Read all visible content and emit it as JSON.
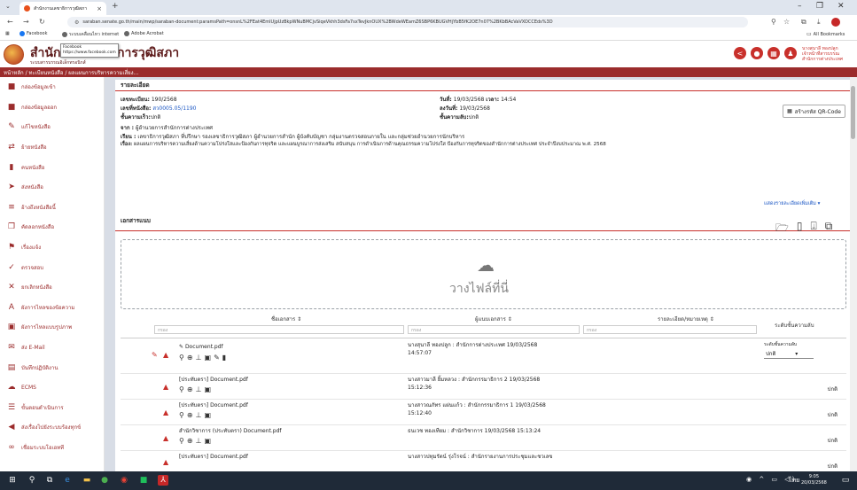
{
  "browser": {
    "tab_title": "สำนักงานเลขาธิการวุฒิสภา",
    "url": "saraban.senate.go.th/main/mwp/saraban-document:paramsPath=onsnL%2FEat4EmlUjpUzBkpWNuBMCjvSiqeVkhh3dsFa7sxTevJknOUX%2BWdeWEamZ6SBP6KBUGVHjYbB5fK2OE7n07%2BKbBAcVaVXOCCEds%3D",
    "bookmarks": [
      "Facebook",
      "ระบบเคลื่อนไหว internet",
      "Adobe Acrobat"
    ],
    "all_bookmarks": "All Bookmarks"
  },
  "header": {
    "app_name": "สำนักงานเลขาธิการวุฒิสภา",
    "app_sub": "ระบบสารบรรณอิเล็กทรอนิกส์",
    "tooltip_title": "Facebook",
    "tooltip_url": "https://www.facebook.com",
    "user_name": "นางสุนาลี ทองปลูก",
    "user_role": "เจ้าหน้าที่สารบรรณ",
    "user_dept": "สำนักการต่างประเทศ"
  },
  "breadcrumb": "หน้าหลัก / ทะเบียนหนังสือ / ผลแผนการบริหารความเสี่ยง...",
  "sidebar": {
    "items": [
      {
        "label": "กล่องข้อมูลเข้า",
        "icon": "inbox-icon"
      },
      {
        "label": "กล่องข้อมูลออก",
        "icon": "outbox-icon"
      },
      {
        "label": "แก้ไขหนังสือ",
        "icon": "edit-icon"
      },
      {
        "label": "ย้ายหนังสือ",
        "icon": "move-icon"
      },
      {
        "label": "คนหนังสือ",
        "icon": "document-icon"
      },
      {
        "label": "ส่งหนังสือ",
        "icon": "send-icon"
      },
      {
        "label": "อ้างถึงหนังสือนี้",
        "icon": "reference-icon"
      },
      {
        "label": "คัดลอกหนังสือ",
        "icon": "copy-icon"
      },
      {
        "label": "เรื่องแจ้ง",
        "icon": "notify-icon"
      },
      {
        "label": "ตรวจสอบ",
        "icon": "check-icon"
      },
      {
        "label": "ยกเลิกหนังสือ",
        "icon": "cancel-icon"
      },
      {
        "label": "ผังการไหลของข้อความ",
        "icon": "flow-icon"
      },
      {
        "label": "ผังการไหลแบบรูปภาพ",
        "icon": "image-icon"
      },
      {
        "label": "ส่ง E-Mail",
        "icon": "mail-icon"
      },
      {
        "label": "บันทึกปฏิบัติงาน",
        "icon": "log-icon"
      },
      {
        "label": "ECMS",
        "icon": "cloud-icon"
      },
      {
        "label": "ขั้นตอนดำเนินการ",
        "icon": "list-icon"
      },
      {
        "label": "ส่งเรื่องไปยังระบบร้องทุกข์",
        "icon": "forward-icon"
      },
      {
        "label": "เชื่อมระบบโอเอทที",
        "icon": "link-icon"
      }
    ]
  },
  "details": {
    "section_title": "รายละเอียด",
    "reg_no_label": "เลขทะเบียน:",
    "reg_no": "190/2568",
    "date_label": "วันที่:",
    "date": "19/03/2568",
    "time_label": "เวลา:",
    "time": "14:54",
    "doc_no_label": "เลขที่หนังสือ:",
    "doc_no": "สว0005.05/1190",
    "sign_date_label": "ลงวันที่:",
    "sign_date": "19/03/2568",
    "urgency_label": "ชั้นความเร็ว:",
    "urgency": "ปกติ",
    "secrecy_label": "ชั้นความลับ:",
    "secrecy": "ปกติ",
    "from_label": "จาก :",
    "from": "ผู้อำนวยการสำนักการต่างประเทศ",
    "to_label": "เรียน :",
    "to": "เลขาธิการวุฒิสภา ที่ปรึกษา รองเลขาธิการวุฒิสภา ผู้อำนวยการสำนัก ผู้บังคับบัญชา กลุ่มงานตรวจสอบภายใน และกลุ่มช่วยอำนวยการนักบริหาร",
    "subject_label": "เรื่อง:",
    "subject": "ผลแผนการบริหารความเสี่ยงด้านความโปร่งใสและป้องกันการทุจริต และแผนบูรณาการส่งเสริม สนับสนุน การดำเนินการด้านคุณธรรมความโปร่งใส ป้องกันการทุจริตของสำนักการต่างประเทศ ประจำปีงบประมาณ พ.ศ. 2568",
    "qr_button": "สร้างรหัส QR-Code",
    "more_link": "แสดงรายละเอียดเพิ่มเติม ▾"
  },
  "attachments": {
    "section_title": "เอกสารแนบ",
    "drop_text": "วางไฟล์ที่นี่",
    "columns": [
      "ชื่อเอกสาร ⇕",
      "ผู้แนบเอกสาร ⇕",
      "รายละเอียด/หมายเหตุ ⇕",
      "ระดับชั้นความลับ"
    ],
    "filter_placeholder": "กรอง",
    "select_label": "ระดับชั้นความลับ",
    "rows": [
      {
        "name": "Document.pdf",
        "uploader": "นางสุนาลี ทองปลูก : สำนักการต่างประเทศ 19/03/2568",
        "time": "14:57:07",
        "level": "ปกติ"
      },
      {
        "name": "[ประทับตรา] Document.pdf",
        "uploader": "นางสาวมาลี ยิ้มหลวง : สำนักกรรมาธิการ 2 19/03/2568",
        "time": "15:12:36",
        "level": "ปกติ"
      },
      {
        "name": "[ประทับตรา] Document.pdf",
        "uploader": "นางสาวณภัทร แผ่นแก้ว : สำนักกรรมาธิการ 1 19/03/2568",
        "time": "15:12:40",
        "level": "ปกติ"
      },
      {
        "name": "สำนักวิชาการ (ประทับตรา) Document.pdf",
        "uploader": "ธนเวช ทองเทียม : สำนักวิชาการ 19/03/2568 15:13:24",
        "time": "",
        "level": "ปกติ"
      },
      {
        "name": "[ประทับตรา] Document.pdf",
        "uploader": "นางสาวปทุมรัตน์ รุ่งโรจน์ : สำนักรายงานการประชุมและชวเลข",
        "time": "",
        "level": "ปกติ"
      }
    ]
  },
  "taskbar": {
    "time": "9:05",
    "date": "20/03/2568",
    "lang": "ไทย"
  }
}
